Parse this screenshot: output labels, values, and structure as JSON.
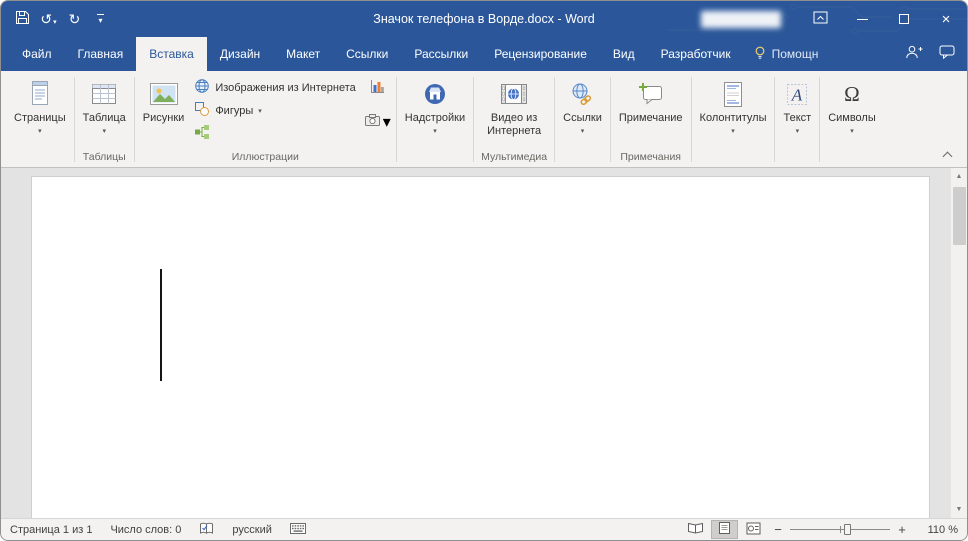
{
  "titlebar": {
    "title": "Значок телефона в Ворде.docx - Word"
  },
  "tabs": {
    "file": "Файл",
    "home": "Главная",
    "insert": "Вставка",
    "design": "Дизайн",
    "layout": "Макет",
    "references": "Ссылки",
    "mailings": "Рассылки",
    "review": "Рецензирование",
    "view": "Вид",
    "developer": "Разработчик",
    "tellme": "Помощн"
  },
  "ribbon": {
    "pages_button": "Страницы",
    "table_button": "Таблица",
    "tables_group": "Таблицы",
    "pictures_button": "Рисунки",
    "online_pictures_button": "Изображения из Интернета",
    "shapes_button": "Фигуры",
    "illustrations_group": "Иллюстрации",
    "addins_button": "Надстройки",
    "online_video_button": "Видео из Интернета",
    "media_group": "Мультимедиа",
    "links_button": "Ссылки",
    "comment_button": "Примечание",
    "comments_group": "Примечания",
    "header_footer_button": "Колонтитулы",
    "text_button": "Текст",
    "symbols_button": "Символы"
  },
  "statusbar": {
    "page_info": "Страница 1 из 1",
    "word_count": "Число слов: 0",
    "language": "русский",
    "zoom_value": "110 %"
  },
  "glyphs": {
    "dropdown": "▾",
    "undo": "↺",
    "redo": "↻",
    "close": "×",
    "omega": "Ω",
    "letter_a": "А",
    "scroll_up": "▲",
    "scroll_down": "▼",
    "zoom_minus": "−",
    "zoom_plus": "+"
  },
  "colors": {
    "titlebar_blue": "#2b579a",
    "ribbon_bg": "#f3f2f1",
    "document_bg": "#e3e3e3",
    "active_tab_text": "#2b579a"
  }
}
